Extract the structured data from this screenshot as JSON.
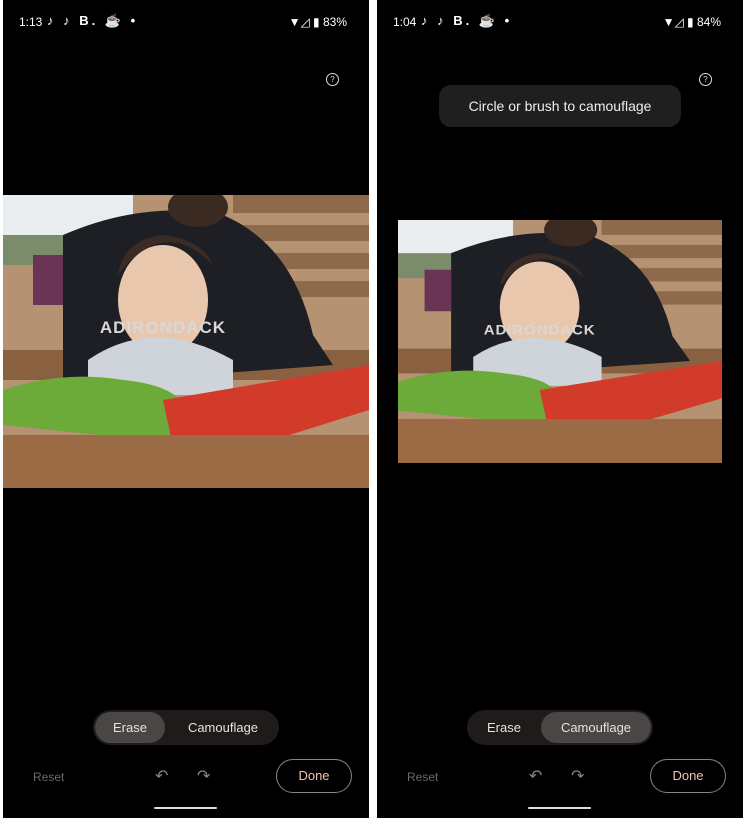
{
  "screens": [
    {
      "status": {
        "time": "1:13",
        "apps": "♪ ♪ B. ☕ •",
        "battery": "83%"
      },
      "help_icon": "?",
      "modes": {
        "erase": "Erase",
        "camouflage": "Camouflage",
        "active": "erase"
      },
      "reset": "Reset",
      "undo_icon": "↶",
      "redo_icon": "↷",
      "done": "Done"
    },
    {
      "status": {
        "time": "1:04",
        "apps": "♪ ♪ B. ☕ •",
        "battery": "84%"
      },
      "help_icon": "?",
      "tooltip": "Circle or brush to camouflage",
      "modes": {
        "erase": "Erase",
        "camouflage": "Camouflage",
        "active": "camouflage"
      },
      "reset": "Reset",
      "undo_icon": "↶",
      "redo_icon": "↷",
      "done": "Done"
    }
  ],
  "photo_shirt_text": "ADIRONDACK"
}
